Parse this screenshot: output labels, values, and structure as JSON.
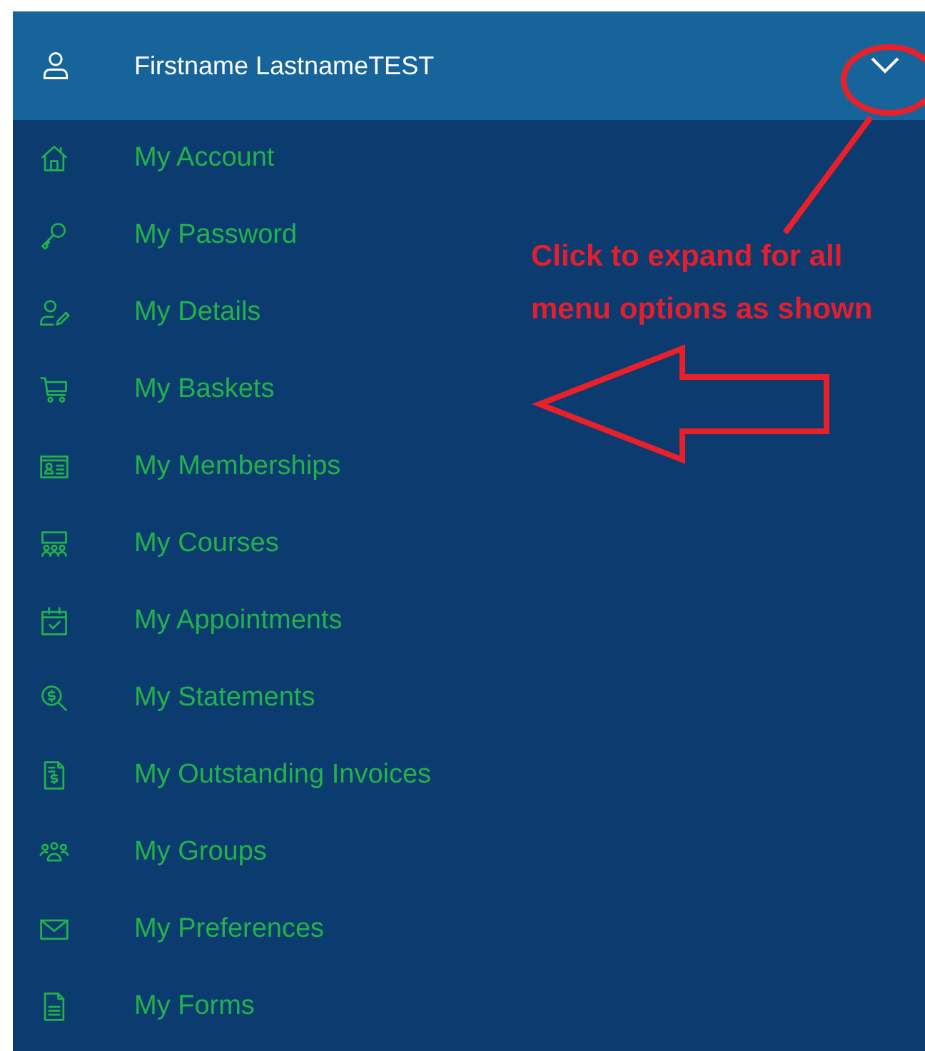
{
  "header": {
    "user_name": "Firstname LastnameTEST",
    "expanded": false
  },
  "menu_items": [
    {
      "label": "My Account"
    },
    {
      "label": "My Password"
    },
    {
      "label": "My Details"
    },
    {
      "label": "My Baskets"
    },
    {
      "label": "My Memberships"
    },
    {
      "label": "My Courses"
    },
    {
      "label": "My Appointments"
    },
    {
      "label": "My Statements"
    },
    {
      "label": "My Outstanding Invoices"
    },
    {
      "label": "My Groups"
    },
    {
      "label": "My Preferences"
    },
    {
      "label": "My Forms"
    }
  ],
  "annotation": {
    "text": "Click to expand for all menu options as shown"
  }
}
